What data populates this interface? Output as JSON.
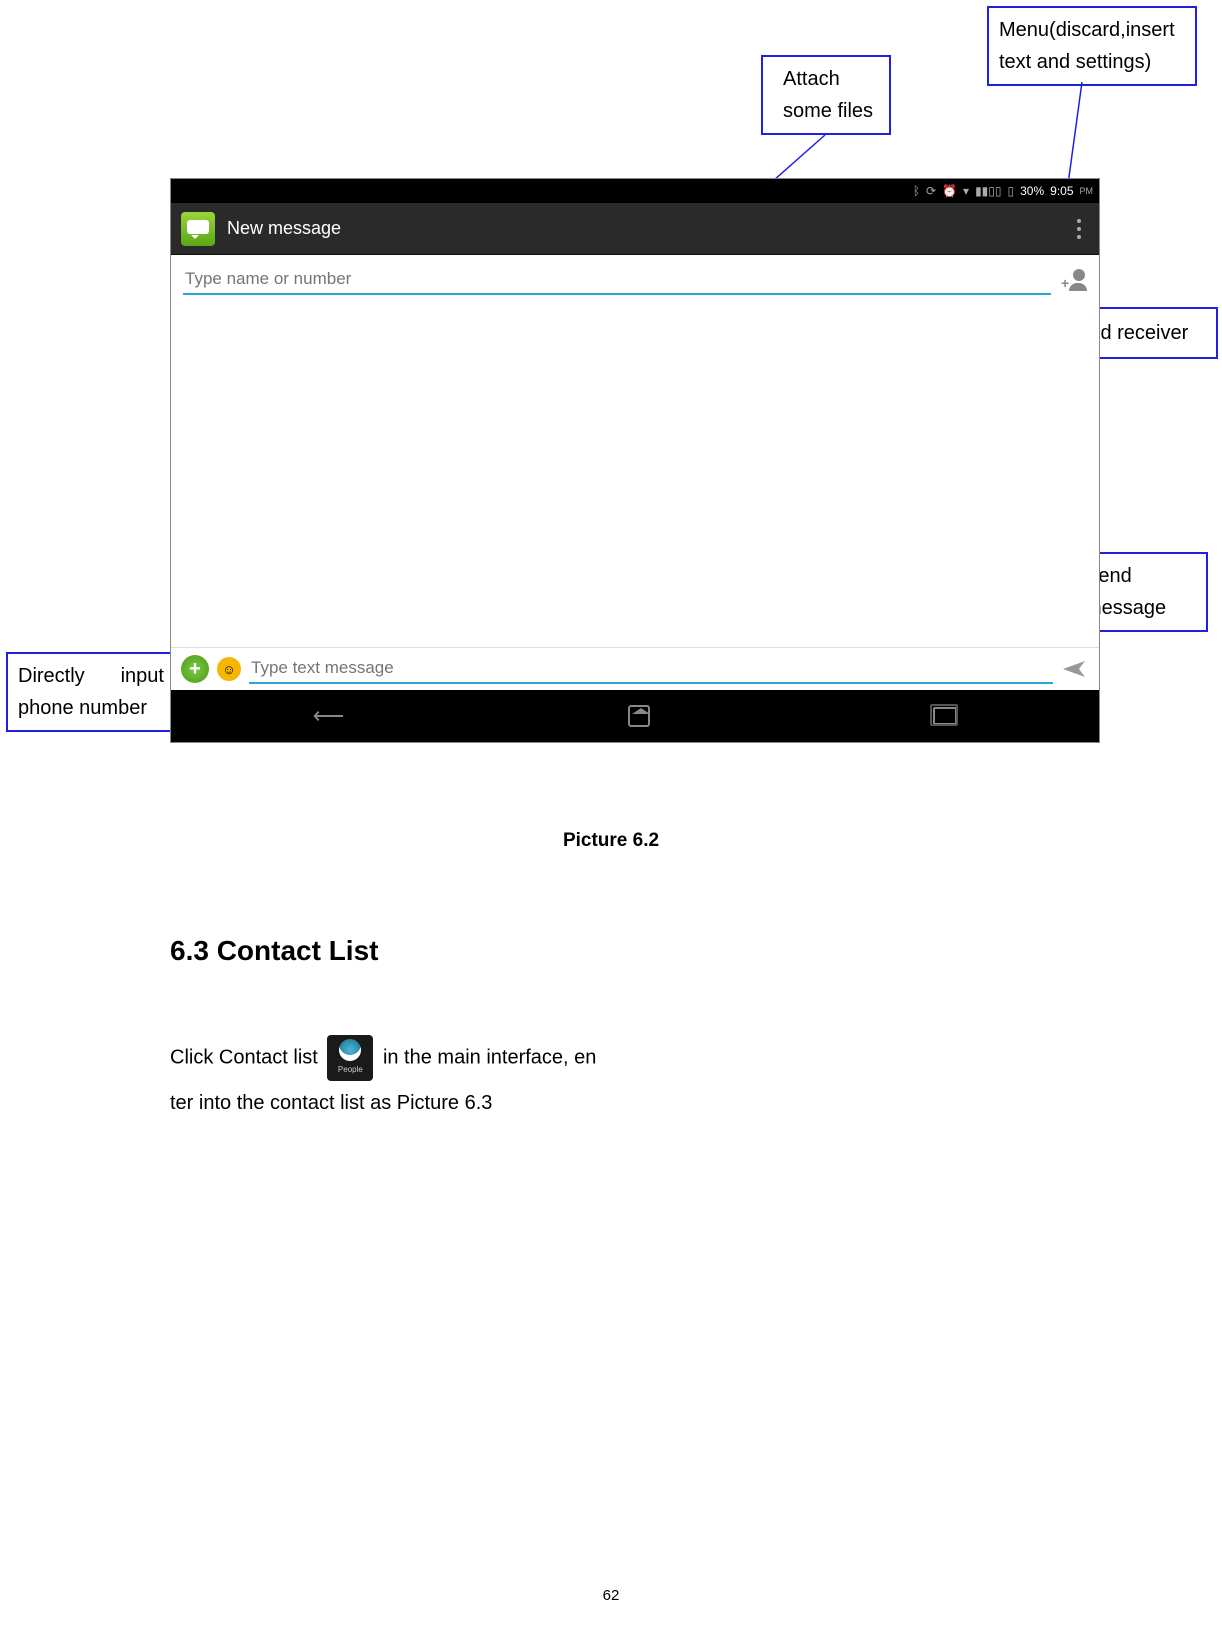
{
  "callouts": {
    "menu": "Menu(discard,insert text and settings)",
    "attach": "Attach some files",
    "add_receiver": "Add receiver",
    "send": "Send message",
    "direct_input": "Directly input phone number"
  },
  "statusbar": {
    "battery": "30%",
    "time": "9:05"
  },
  "app": {
    "title": "New message",
    "recipient_placeholder": "Type name or number",
    "text_placeholder": "Type text message"
  },
  "caption": "Picture 6.2",
  "section": {
    "heading": "6.3 Contact List",
    "line1a": "Click Contact list ",
    "line1b": " in the main interface, en",
    "line2": "ter into the contact list as Picture 6.3",
    "people_label": "People"
  },
  "page_number": "62",
  "time_suffix": "PM"
}
